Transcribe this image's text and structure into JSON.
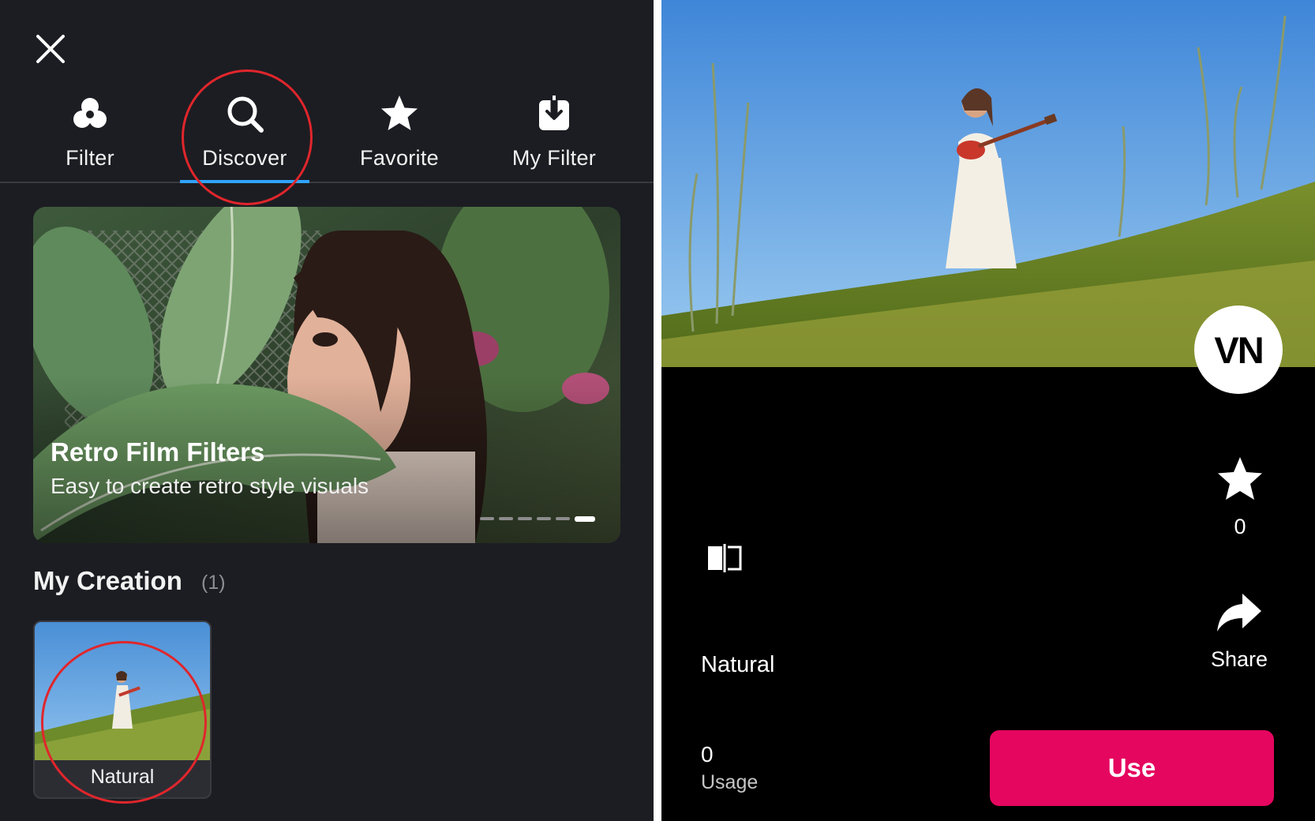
{
  "left_panel": {
    "tabs": [
      {
        "label": "Filter",
        "icon": "filter-circles-icon",
        "active": false
      },
      {
        "label": "Discover",
        "icon": "search-icon",
        "active": true
      },
      {
        "label": "Favorite",
        "icon": "star-icon",
        "active": false
      },
      {
        "label": "My Filter",
        "icon": "download-box-icon",
        "active": false
      }
    ],
    "banner": {
      "title": "Retro Film Filters",
      "subtitle": "Easy to create retro style visuals",
      "page_count": 6,
      "active_page": 6
    },
    "my_creation": {
      "title": "My Creation",
      "count": "(1)",
      "items": [
        {
          "label": "Natural"
        }
      ]
    }
  },
  "right_panel": {
    "logo": "VN",
    "favorite_count": "0",
    "share_label": "Share",
    "filter_name": "Natural",
    "usage_count": "0",
    "usage_label": "Usage",
    "use_button": "Use"
  },
  "colors": {
    "left_bg": "#1c1d22",
    "right_bg": "#000000",
    "accent_underline": "#2fa3ff",
    "use_button": "#e5065f",
    "annotation_red": "#e0262c"
  }
}
